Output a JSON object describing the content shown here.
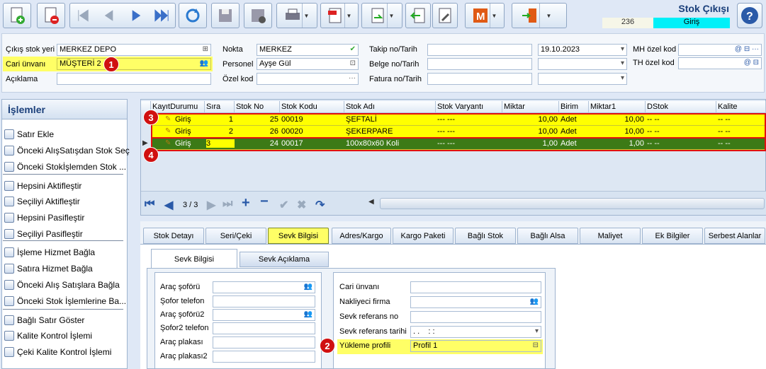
{
  "window": {
    "title": "Stok Çıkışı",
    "doc_no": "236",
    "status": "Giriş"
  },
  "header": {
    "cikis_stok_yeri_label": "Çıkış stok yeri",
    "cikis_stok_yeri": "MERKEZ DEPO",
    "cari_unvani_label": "Cari ünvanı",
    "cari_unvani": "MÜŞTERİ 2",
    "aciklama_label": "Açıklama",
    "aciklama": "",
    "nokta_label": "Nokta",
    "nokta": "MERKEZ",
    "personel_label": "Personel",
    "personel": "Ayşe Gül",
    "ozel_kod_label": "Özel kod",
    "ozel_kod": "",
    "takip_label": "Takip no/Tarih",
    "takip_tarih": "19.10.2023",
    "belge_label": "Belge no/Tarih",
    "fatura_label": "Fatura no/Tarih",
    "mh_label": "MH özel kod",
    "th_label": "TH özel kod"
  },
  "sidebar": {
    "title": "İşlemler",
    "items": [
      "Satır Ekle",
      "Önceki AlışSatışdan Stok Seç",
      "Önceki Stokİşlemden Stok ...",
      "Hepsini Aktifleştir",
      "Seçiliyi Aktifleştir",
      "Hepsini Pasifleştir",
      "Seçiliyi Pasifleştir",
      "İşleme Hizmet Bağla",
      "Satıra Hizmet Bağla",
      "Önceki Alış Satışlara Bağla",
      "Önceki Stok İşlemlerine Ba...",
      "Bağlı Satır Göster",
      "Kalite Kontrol İşlemi",
      "Çeki Kalite Kontrol İşlemi"
    ]
  },
  "grid": {
    "columns": [
      "KayıtDurumu",
      "Sıra",
      "Stok No",
      "Stok Kodu",
      "Stok Adı",
      "Stok Varyantı",
      "Miktar",
      "Birim",
      "Miktar1",
      "DStok",
      "Kalite"
    ],
    "rows": [
      [
        "Giriş",
        "1",
        "25",
        "00019",
        "ŞEFTALİ",
        "--- ---",
        "10,00",
        "Adet",
        "10,00",
        "-- --",
        "-- --"
      ],
      [
        "Giriş",
        "2",
        "26",
        "00020",
        "ŞEKERPARE",
        "--- ---",
        "10,00",
        "Adet",
        "10,00",
        "-- --",
        "-- --"
      ],
      [
        "Giriş",
        "3",
        "24",
        "00017",
        "100x80x60 Koli",
        "--- ---",
        "1,00",
        "Adet",
        "1,00",
        "-- --",
        "-- --"
      ]
    ],
    "pager": "3 / 3"
  },
  "tabs": [
    "Stok Detayı",
    "Seri/Çeki",
    "Sevk Bilgisi",
    "Adres/Kargo",
    "Kargo Paketi",
    "Bağlı Stok",
    "Bağlı Alsa",
    "Maliyet",
    "Ek Bilgiler",
    "Serbest Alanlar"
  ],
  "subtabs": [
    "Sevk Bilgisi",
    "Sevk Açıklama"
  ],
  "sevk_left": [
    "Araç şoförü",
    "Şofor telefon",
    "Araç şoförü2",
    "Şofor2 telefon",
    "Araç plakası",
    "Araç plakası2"
  ],
  "sevk_right": {
    "labels": [
      "Cari ünvanı",
      "Nakliyeci firma",
      "Sevk referans no",
      "Sevk referans tarihi",
      "Yükleme profili"
    ],
    "tarih": ". .    : :",
    "profil": "Profil 1"
  },
  "badges": [
    "1",
    "2",
    "3",
    "4"
  ]
}
